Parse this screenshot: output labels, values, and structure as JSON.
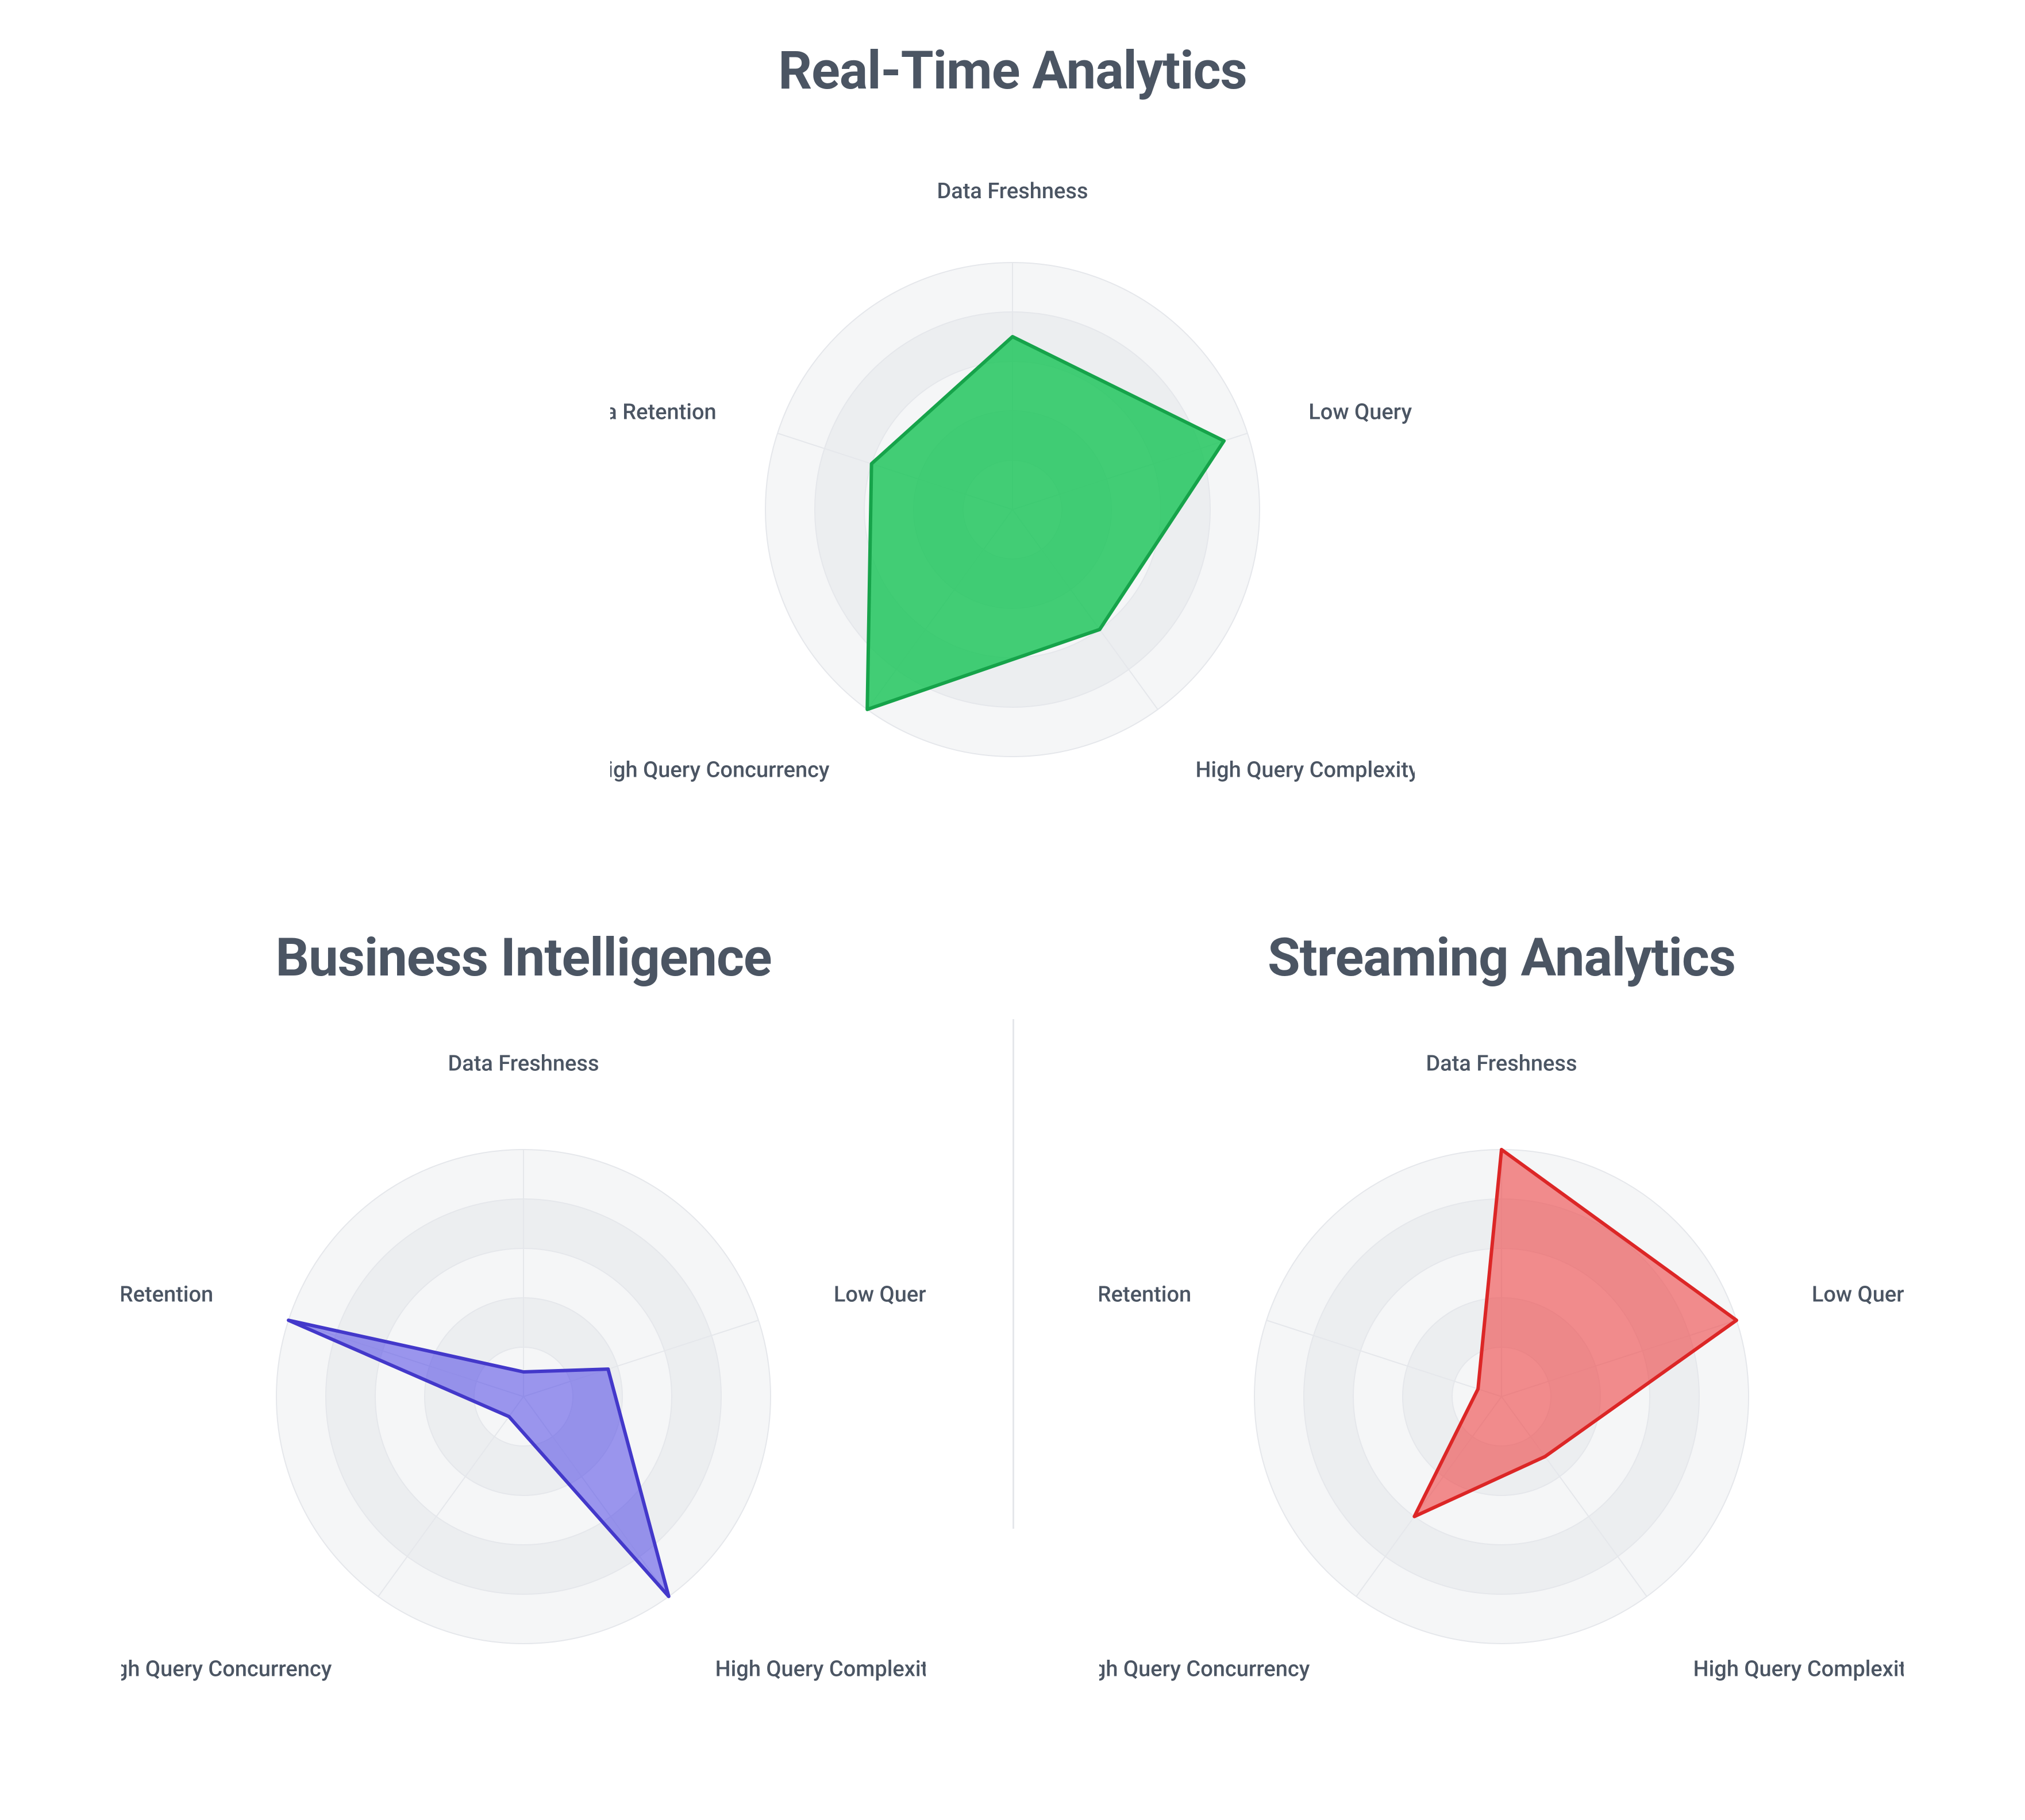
{
  "chart_data": [
    {
      "id": "realtime",
      "title": "Real-Time Analytics",
      "type": "radar",
      "categories": [
        "Data Freshness",
        "Low Query Latency",
        "High Query Complexity",
        "High Query Concurrency",
        "Long Data Retention"
      ],
      "values": [
        3.5,
        4.5,
        3.0,
        5.0,
        3.0
      ],
      "max": 5,
      "rings": 5,
      "fill": "#22c55e",
      "fillOpacity": 0.85,
      "stroke": "#16a34a",
      "labelDistance": 1.26
    },
    {
      "id": "bi",
      "title": "Business Intelligence",
      "type": "radar",
      "categories": [
        "Data Freshness",
        "Low Query Latency",
        "High Query Complexity",
        "High Query Concurrency",
        "Long Data Retention"
      ],
      "values": [
        0.5,
        1.8,
        5.0,
        0.5,
        5.0
      ],
      "max": 5,
      "rings": 5,
      "fill": "#4f46e5",
      "fillOpacity": 0.55,
      "stroke": "#4338ca",
      "labelDistance": 1.32
    },
    {
      "id": "streaming",
      "title": "Streaming Analytics",
      "type": "radar",
      "categories": [
        "Data Freshness",
        "Low Query Latency",
        "High Query Complexity",
        "High Query Concurrency",
        "Long Data Retention"
      ],
      "values": [
        5.0,
        5.0,
        1.5,
        3.0,
        0.5
      ],
      "max": 5,
      "rings": 5,
      "fill": "#ef4444",
      "fillOpacity": 0.6,
      "stroke": "#dc2626",
      "labelDistance": 1.32
    }
  ],
  "colors": {
    "titleText": "#4b5563",
    "axisText": "#4b5563",
    "ringLight": "#fafafa",
    "ringDark": "#f3f4f6",
    "ringStroke": "#e5e7eb",
    "divider": "#e5e7eb"
  }
}
